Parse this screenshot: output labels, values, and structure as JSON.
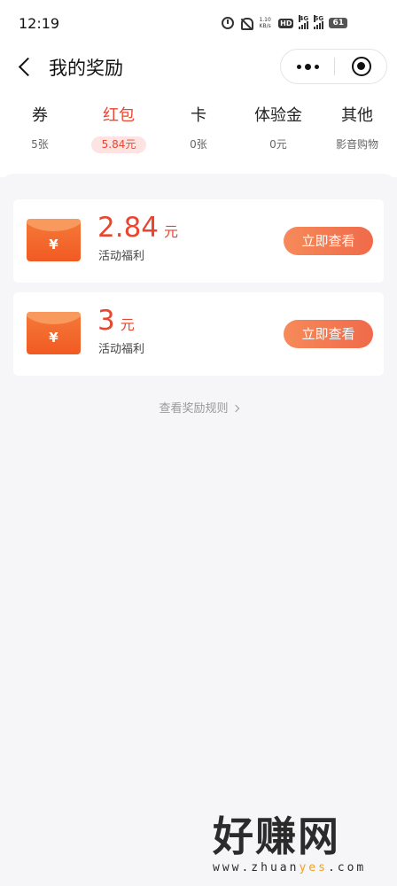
{
  "status_bar": {
    "time": "12:19",
    "net_speed_value": "1.10",
    "net_speed_unit": "KB/s",
    "hd_badge": "HD",
    "signal1_label": "4G",
    "signal2_label": "5G",
    "battery": "61"
  },
  "nav": {
    "title": "我的奖励"
  },
  "tabs": [
    {
      "label": "券",
      "sub": "5张"
    },
    {
      "label": "红包",
      "sub": "5.84元",
      "active": true
    },
    {
      "label": "卡",
      "sub": "0张"
    },
    {
      "label": "体验金",
      "sub": "0元"
    },
    {
      "label": "其他",
      "sub": "影音购物"
    }
  ],
  "rewards": [
    {
      "amount": "2.84",
      "unit": "元",
      "desc": "活动福利",
      "button": "立即查看",
      "symbol": "¥"
    },
    {
      "amount": "3",
      "unit": "元",
      "desc": "活动福利",
      "button": "立即查看",
      "symbol": "¥"
    }
  ],
  "rules_link": "查看奖励规则",
  "watermark": {
    "logo": "好赚网",
    "url_pre": "www.zhuan",
    "url_hl": "yes",
    "url_post": ".com"
  },
  "colors": {
    "accent": "#e9452f",
    "button": "#f06a4a",
    "background": "#f6f6f8"
  }
}
